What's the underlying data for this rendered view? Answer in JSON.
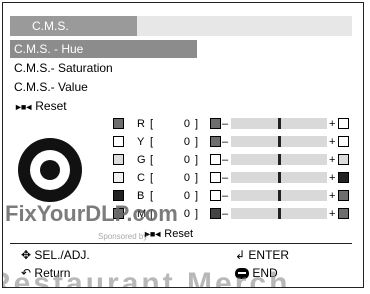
{
  "header": {
    "title": "C.M.S."
  },
  "menu": {
    "items": [
      {
        "label": "C.M.S. - Hue",
        "selected": true
      },
      {
        "label": "C.M.S.- Saturation",
        "selected": false
      },
      {
        "label": "C.M.S.- Value",
        "selected": false
      },
      {
        "label": "Reset",
        "selected": false
      }
    ]
  },
  "adjust": {
    "rows": [
      {
        "channel": "R",
        "value": "0",
        "swatch_color": "#6e6e6e",
        "left_color": "#6e6e6e",
        "right_color": "#ffffff",
        "level_pct": 50
      },
      {
        "channel": "Y",
        "value": "0",
        "swatch_color": "#ffffff",
        "left_color": "#6e6e6e",
        "right_color": "#ffffff",
        "level_pct": 50
      },
      {
        "channel": "G",
        "value": "0",
        "swatch_color": "#dcdcdc",
        "left_color": "#ffffff",
        "right_color": "#dcdcdc",
        "level_pct": 50
      },
      {
        "channel": "C",
        "value": "0",
        "swatch_color": "#f0f0f0",
        "left_color": "#ffffff",
        "right_color": "#222222",
        "level_pct": 50
      },
      {
        "channel": "B",
        "value": "0",
        "swatch_color": "#222222",
        "left_color": "#ffffff",
        "right_color": "#6e6e6e",
        "level_pct": 50
      },
      {
        "channel": "M",
        "value": "0",
        "swatch_color": "#6e6e6e",
        "left_color": "#444444",
        "right_color": "#6e6e6e",
        "level_pct": 50
      }
    ],
    "reset_label": "Reset"
  },
  "footer": {
    "sel_label": "SEL./ADJ.",
    "enter_label": "ENTER",
    "return_label": "Return",
    "end_label": "END"
  },
  "watermarks": {
    "brand": "FixYourDLP.com",
    "sponsor": "Sponsored by",
    "big": "Restaurant Merch"
  },
  "icons": {
    "sel": "four-way-arrow-icon",
    "enter": "enter-arrow-icon",
    "return": "return-arrow-icon",
    "end": "end-button-icon",
    "reset": "reset-arrows-icon"
  }
}
